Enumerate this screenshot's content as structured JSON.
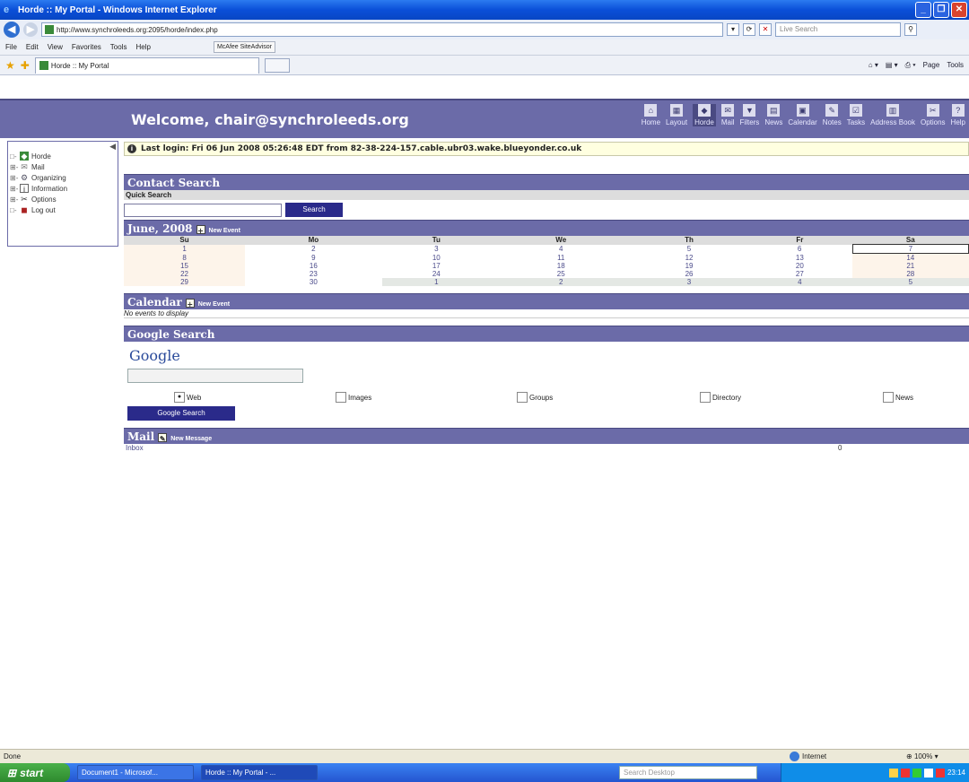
{
  "window": {
    "title": "Horde :: My Portal - Windows Internet Explorer"
  },
  "browser": {
    "url": "http://www.synchroleeds.org:2095/horde/index.php",
    "live_search_placeholder": "Live Search",
    "menu": [
      "File",
      "Edit",
      "View",
      "Favorites",
      "Tools",
      "Help"
    ],
    "mcafee": "McAfee SiteAdvisor",
    "tab_title": "Horde :: My Portal",
    "commands": [
      "Page",
      "Tools"
    ],
    "status_left": "Done",
    "status_zone": "Internet",
    "zoom": "100%"
  },
  "header": {
    "welcome": "Welcome, chair@synchroleeds.org",
    "nav": [
      {
        "label": "Home",
        "icon": "home-icon"
      },
      {
        "label": "Layout",
        "icon": "layout-icon"
      },
      {
        "label": "Horde",
        "icon": "horde-icon",
        "active": true
      },
      {
        "label": "Mail",
        "icon": "mail-icon"
      },
      {
        "label": "Filters",
        "icon": "filter-icon"
      },
      {
        "label": "News",
        "icon": "news-icon"
      },
      {
        "label": "Calendar",
        "icon": "calendar-icon"
      },
      {
        "label": "Notes",
        "icon": "notes-icon"
      },
      {
        "label": "Tasks",
        "icon": "tasks-icon"
      },
      {
        "label": "Address Book",
        "icon": "address-book-icon"
      },
      {
        "label": "Options",
        "icon": "options-icon"
      },
      {
        "label": "Help",
        "icon": "help-icon"
      }
    ]
  },
  "sidebar": {
    "items": [
      {
        "label": "Horde",
        "icon": "horde-icon",
        "prefix": "□-"
      },
      {
        "label": "Mail",
        "icon": "mail-icon",
        "prefix": "⊞-"
      },
      {
        "label": "Organizing",
        "icon": "organizing-icon",
        "prefix": "⊞-"
      },
      {
        "label": "Information",
        "icon": "information-icon",
        "prefix": "⊞-"
      },
      {
        "label": "Options",
        "icon": "options-icon",
        "prefix": "⊞-"
      },
      {
        "label": "Log out",
        "icon": "logout-icon",
        "prefix": "□-"
      }
    ]
  },
  "last_login": "Last login: Fri 06 Jun 2008 05:26:48 EDT from 82-38-224-157.cable.ubr03.wake.blueyonder.co.uk",
  "contact_search": {
    "title": "Contact Search",
    "subtitle": "Quick Search",
    "button": "Search"
  },
  "month_calendar": {
    "title": "June, 2008",
    "new_event": "New Event",
    "days": [
      "Su",
      "Mo",
      "Tu",
      "We",
      "Th",
      "Fr",
      "Sa"
    ],
    "weeks": [
      [
        "1",
        "2",
        "3",
        "4",
        "5",
        "6",
        "7"
      ],
      [
        "8",
        "9",
        "10",
        "11",
        "12",
        "13",
        "14"
      ],
      [
        "15",
        "16",
        "17",
        "18",
        "19",
        "20",
        "21"
      ],
      [
        "22",
        "23",
        "24",
        "25",
        "26",
        "27",
        "28"
      ],
      [
        "29",
        "30",
        "1",
        "2",
        "3",
        "4",
        "5"
      ]
    ],
    "today": "7"
  },
  "calendar": {
    "title": "Calendar",
    "new_event": "New Event",
    "empty": "No events to display"
  },
  "google": {
    "title": "Google Search",
    "logo": "Google",
    "options": [
      "Web",
      "Images",
      "Groups",
      "Directory",
      "News"
    ],
    "selected": "Web",
    "button": "Google Search"
  },
  "mail": {
    "title": "Mail",
    "new_message": "New Message",
    "folder": "Inbox",
    "count": "0"
  },
  "taskbar": {
    "start": "start",
    "tasks": [
      "Document1 - Microsof...",
      "Horde :: My Portal - ..."
    ],
    "search_placeholder": "Search Desktop",
    "clock": "23:14"
  }
}
